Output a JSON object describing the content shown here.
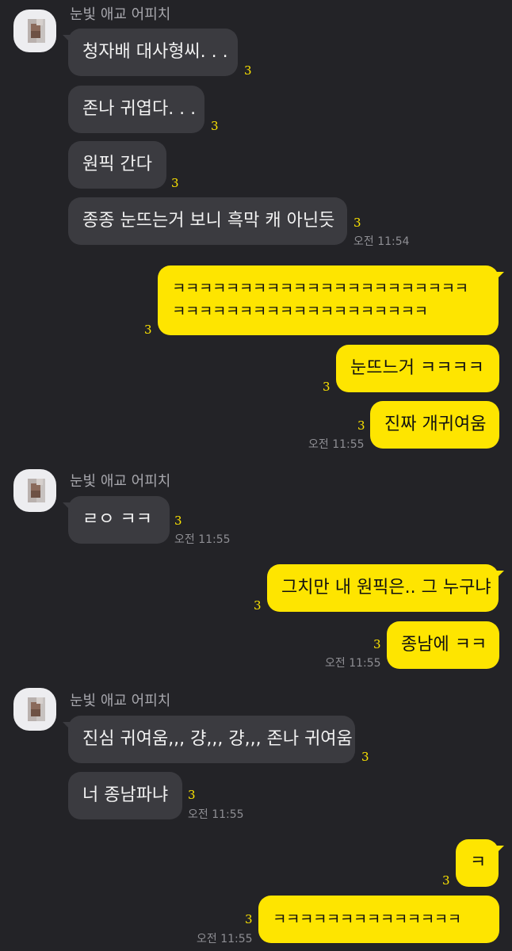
{
  "colors": {
    "background": "#232327",
    "incoming_bubble": "#3b3b40",
    "outgoing_bubble": "#fee500",
    "unread": "#fee500"
  },
  "sender_name": "눈빛 애교 어피치",
  "unread_count": "3",
  "messages": [
    {
      "text": "청자배 대사형씨. . ."
    },
    {
      "text": "존나 귀엽다. . ."
    },
    {
      "text": "원픽 간다"
    },
    {
      "text": "종종 눈뜨는거 보니 흑막 캐 아닌듯",
      "time": "오전 11:54"
    },
    {
      "line1": "ㅋㅋㅋㅋㅋㅋㅋㅋㅋㅋㅋㅋㅋㅋㅋㅋㅋㅋㅋㅋㅋㅋ",
      "line2": "ㅋㅋㅋㅋㅋㅋㅋㅋㅋㅋㅋㅋㅋㅋㅋㅋㅋㅋㅋ"
    },
    {
      "text": "눈뜨느거 ㅋㅋㅋㅋ"
    },
    {
      "text": "진짜 개귀여움",
      "time": "오전 11:55"
    },
    {
      "text": "ㄹㅇ ㅋㅋ",
      "time": "오전 11:55"
    },
    {
      "text": "그치만 내 원픽은.. 그 누구냐"
    },
    {
      "text": "종남에 ㅋㅋ",
      "time": "오전 11:55"
    },
    {
      "text": "진심 귀여움,,, 걍,,, 걍,,, 존나 귀여움"
    },
    {
      "text": "너 종남파냐",
      "time": "오전 11:55"
    },
    {
      "text": "ㅋ"
    },
    {
      "text": "ㅋㅋㅋㅋㅋㅋㅋㅋㅋㅋㅋㅋㅋㅋ",
      "time": "오전 11:55"
    }
  ]
}
